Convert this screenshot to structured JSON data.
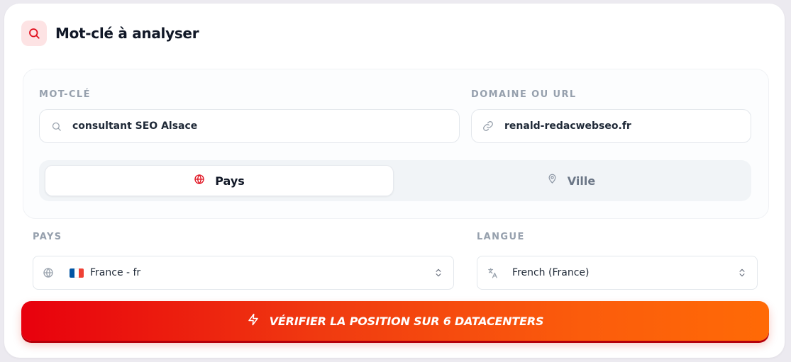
{
  "header": {
    "title": "Mot-clé à analyser"
  },
  "keyword": {
    "label": "MOT-CLÉ",
    "value": "consultant SEO Alsace"
  },
  "domain": {
    "label": "DOMAINE OU URL",
    "value": "renald-redacwebseo.fr"
  },
  "location_toggle": {
    "options": [
      {
        "label": "Pays",
        "selected": true
      },
      {
        "label": "Ville",
        "selected": false
      }
    ]
  },
  "country": {
    "label": "PAYS",
    "value": "France - fr",
    "flag_colors": [
      "#0055a4",
      "#ffffff",
      "#ef4135"
    ]
  },
  "language": {
    "label": "LANGUE",
    "value": "French (France)"
  },
  "cta": {
    "label": "VÉRIFIER LA POSITION SUR 6 DATACENTERS"
  },
  "colors": {
    "accent": "#e8000d",
    "accent_end": "#ff6a06",
    "label": "#96a0ad"
  }
}
